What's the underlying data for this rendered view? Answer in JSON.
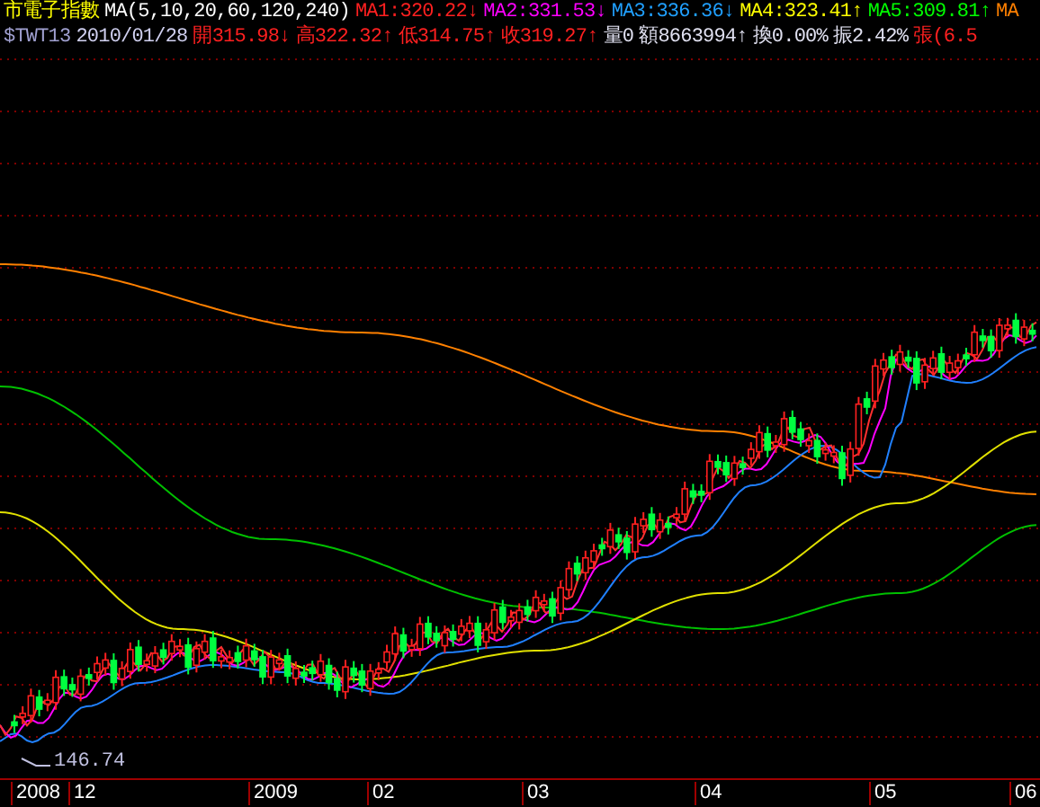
{
  "header_rows": [
    [
      {
        "text": "市電子指數",
        "color": "#ffff00"
      },
      {
        "text": "MA(5,10,20,60,120,240)",
        "color": "#ffffff"
      },
      {
        "text": "MA1:320.22",
        "color": "#ff2020",
        "arrow": "↓"
      },
      {
        "text": "MA2:331.53",
        "color": "#ff00ff",
        "arrow": "↓"
      },
      {
        "text": "MA3:336.36",
        "color": "#20a0ff",
        "arrow": "↓"
      },
      {
        "text": "MA4:323.41",
        "color": "#ffff00",
        "arrow": "↑"
      },
      {
        "text": "MA5:309.81",
        "color": "#00ff00",
        "arrow": "↑"
      },
      {
        "text": "MA",
        "color": "#ff8000"
      }
    ],
    [
      {
        "text": "$TWT13",
        "color": "#a0a0d0"
      },
      {
        "text": "2010/01/28",
        "color": "#d0d0f0"
      },
      {
        "text": "開315.98",
        "color": "#ff2020",
        "arrow": "↓"
      },
      {
        "text": "高322.32",
        "color": "#ff2020",
        "arrow": "↑"
      },
      {
        "text": "低314.75",
        "color": "#ff2020",
        "arrow": "↑"
      },
      {
        "text": "收319.27",
        "color": "#ff2020",
        "arrow": "↑"
      },
      {
        "text": "量0",
        "color": "#e0e0f0"
      },
      {
        "text": "額8663994",
        "color": "#e0e0f0",
        "arrow": "↑"
      },
      {
        "text": "換0.00%",
        "color": "#e0e0f0"
      },
      {
        "text": "振2.42%",
        "color": "#e0e0f0"
      },
      {
        "text": "張(6.5",
        "color": "#ff2020"
      }
    ]
  ],
  "low_marker": "146.74",
  "time_axis": [
    "2008",
    "12",
    "2009",
    "02",
    "03",
    "04",
    "05",
    "06"
  ]
}
